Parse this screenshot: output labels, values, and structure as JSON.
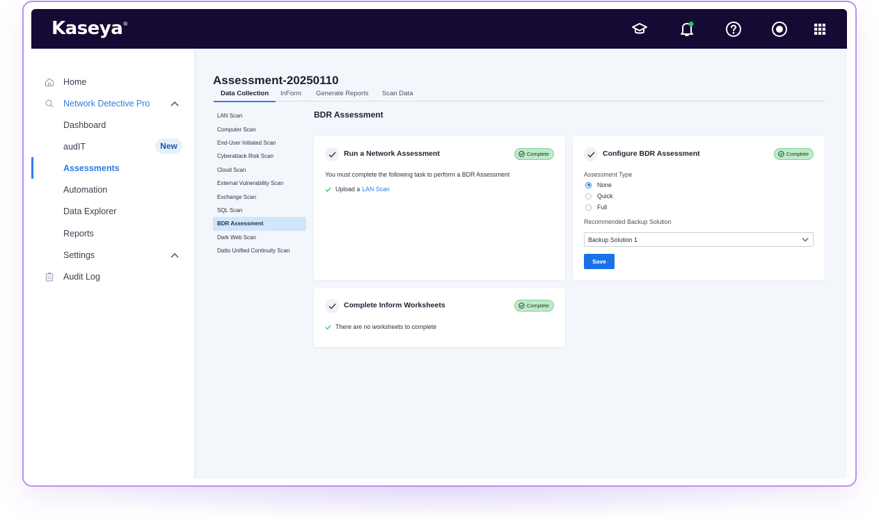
{
  "app": {
    "brand": "Kaseya",
    "trademark": "®"
  },
  "topbar": {
    "icons": [
      "graduation-cap-icon",
      "bell-icon",
      "help-icon",
      "user-icon",
      "apps-grid-icon"
    ],
    "notification_color": "#22c55e"
  },
  "sidebar": {
    "items": [
      {
        "label": "Home",
        "icon": "home-icon"
      },
      {
        "label": "Network Detective Pro",
        "icon": "search-icon"
      },
      {
        "label": "Dashboard"
      },
      {
        "label": "audIT",
        "badge": "New"
      },
      {
        "label": "Assessments"
      },
      {
        "label": "Automation"
      },
      {
        "label": "Data Explorer"
      },
      {
        "label": "Reports"
      },
      {
        "label": "Settings"
      },
      {
        "label": "Audit Log",
        "icon": "clipboard-icon"
      }
    ]
  },
  "main": {
    "title": "Assessment-20250110",
    "tabs": [
      "Data Collection",
      "InForm",
      "Generate Reports",
      "Scan Data"
    ],
    "scans": [
      "LAN Scan",
      "Computer Scan",
      "End-User Initiated Scan",
      "Cyberattack Risk Scan",
      "Cloud Scan",
      "External Vulnerability Scan",
      "Exchange Scan",
      "SQL Scan",
      "BDR Assessment",
      "Dark Web Scan",
      "Datto Unified Continuity Scan"
    ],
    "section_title": "BDR Assessment",
    "card_network": {
      "title": "Run a Network Assessment",
      "status": "Complete",
      "description": "You must complete the following task to perform a BDR Assessment",
      "task_prefix": "Upload a",
      "task_link": "LAN Scan"
    },
    "card_configure": {
      "title": "Configure BDR Assessment",
      "status": "Complete",
      "assessment_type_label": "Assessment Type",
      "options": [
        "None",
        "Quick",
        "Full"
      ],
      "selected_option": "None",
      "backup_label": "Recommended Backup Solution",
      "backup_value": "Backup Solution 1",
      "save_label": "Save"
    },
    "card_inform": {
      "title": "Complete Inform Worksheets",
      "status": "Complete",
      "task_text": "There are no worksheets to complete"
    }
  },
  "colors": {
    "accent": "#2f7be6",
    "topbar": "#150a33",
    "complete_bg": "#bfeac9",
    "frame": "#b98ef5"
  }
}
